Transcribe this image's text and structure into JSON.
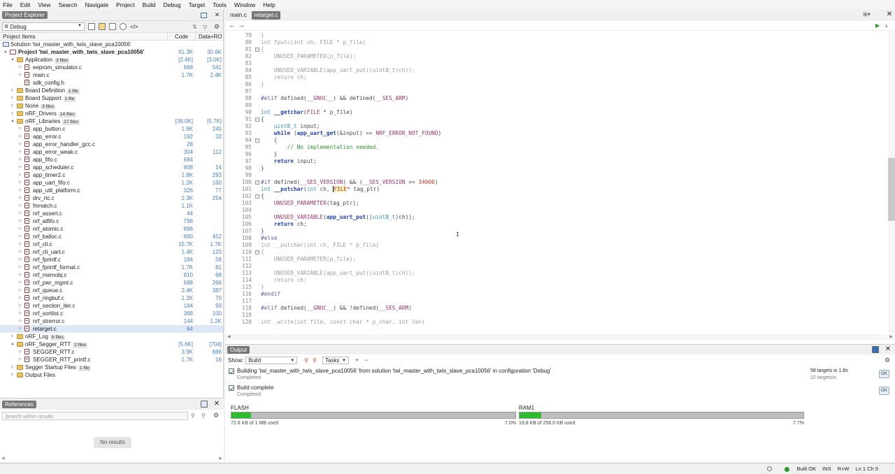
{
  "menu": [
    "File",
    "Edit",
    "View",
    "Search",
    "Navigate",
    "Project",
    "Build",
    "Debug",
    "Target",
    "Tools",
    "Window",
    "Help"
  ],
  "project_explorer": {
    "title": "Project Explorer",
    "config": "Debug",
    "columns": {
      "items": "Project Items",
      "code": "Code",
      "data": "Data+RO"
    },
    "tree": [
      {
        "label": "Solution 'twi_master_with_twis_slave_pca10056'",
        "kind": "sol",
        "depth": 0,
        "tw": "",
        "code": "",
        "data": ""
      },
      {
        "label": "Project 'twi_master_with_twis_slave_pca10056'",
        "kind": "proj",
        "depth": 0,
        "tw": "▲",
        "code": "61.3K",
        "data": "30.6K",
        "bold": true
      },
      {
        "label": "Application",
        "kind": "folder",
        "depth": 1,
        "tw": "▲",
        "badge": "3 files",
        "code": "[2.4K]",
        "data": "[3.0K]"
      },
      {
        "label": "eeprom_simulator.c",
        "kind": "file",
        "depth": 2,
        "tw": "▷",
        "code": "688",
        "data": "541"
      },
      {
        "label": "main.c",
        "kind": "file",
        "depth": 2,
        "tw": "▷",
        "code": "1.7K",
        "data": "2.4K"
      },
      {
        "label": "sdk_config.h",
        "kind": "file",
        "depth": 2,
        "tw": "",
        "code": "",
        "data": ""
      },
      {
        "label": "Board Definition",
        "kind": "folder",
        "depth": 1,
        "tw": "▷",
        "badge": "1 file",
        "code": "",
        "data": ""
      },
      {
        "label": "Board Support",
        "kind": "folder",
        "depth": 1,
        "tw": "▷",
        "badge": "1 file",
        "code": "",
        "data": ""
      },
      {
        "label": "None",
        "kind": "folder",
        "depth": 1,
        "tw": "▷",
        "badge": "3 files",
        "code": "",
        "data": ""
      },
      {
        "label": "nRF_Drivers",
        "kind": "folder",
        "depth": 1,
        "tw": "▷",
        "badge": "14 files",
        "code": "",
        "data": ""
      },
      {
        "label": "nRF_Libraries",
        "kind": "folder",
        "depth": 1,
        "tw": "▲",
        "badge": "27 files",
        "code": "[38.0K]",
        "data": "[5.7K]"
      },
      {
        "label": "app_button.c",
        "kind": "file",
        "depth": 2,
        "tw": "▷",
        "code": "1.6K",
        "data": "245"
      },
      {
        "label": "app_error.c",
        "kind": "file",
        "depth": 2,
        "tw": "▷",
        "code": "192",
        "data": "32"
      },
      {
        "label": "app_error_handler_gcc.c",
        "kind": "file",
        "depth": 2,
        "tw": "▷",
        "code": "28",
        "data": ""
      },
      {
        "label": "app_error_weak.c",
        "kind": "file",
        "depth": 2,
        "tw": "▷",
        "code": "304",
        "data": "112"
      },
      {
        "label": "app_fifo.c",
        "kind": "file",
        "depth": 2,
        "tw": "▷",
        "code": "684",
        "data": ""
      },
      {
        "label": "app_scheduler.c",
        "kind": "file",
        "depth": 2,
        "tw": "▷",
        "code": "808",
        "data": "14"
      },
      {
        "label": "app_timer2.c",
        "kind": "file",
        "depth": 2,
        "tw": "▷",
        "code": "1.8K",
        "data": "293"
      },
      {
        "label": "app_uart_fifo.c",
        "kind": "file",
        "depth": 2,
        "tw": "▷",
        "code": "1.2K",
        "data": "160"
      },
      {
        "label": "app_util_platform.c",
        "kind": "file",
        "depth": 2,
        "tw": "▷",
        "code": "326",
        "data": "77"
      },
      {
        "label": "drv_rtc.c",
        "kind": "file",
        "depth": 2,
        "tw": "▷",
        "code": "2.3K",
        "data": "254"
      },
      {
        "label": "fnmatch.c",
        "kind": "file",
        "depth": 2,
        "tw": "▷",
        "code": "1.1K",
        "data": ""
      },
      {
        "label": "nrf_assert.c",
        "kind": "file",
        "depth": 2,
        "tw": "▷",
        "code": "44",
        "data": ""
      },
      {
        "label": "nrf_atfifo.c",
        "kind": "file",
        "depth": 2,
        "tw": "▷",
        "code": "796",
        "data": ""
      },
      {
        "label": "nrf_atomic.c",
        "kind": "file",
        "depth": 2,
        "tw": "▷",
        "code": "896",
        "data": ""
      },
      {
        "label": "nrf_balloc.c",
        "kind": "file",
        "depth": 2,
        "tw": "▷",
        "code": "890",
        "data": "452"
      },
      {
        "label": "nrf_cli.c",
        "kind": "file",
        "depth": 2,
        "tw": "▷",
        "code": "15.7K",
        "data": "1.7K"
      },
      {
        "label": "nrf_cli_uart.c",
        "kind": "file",
        "depth": 2,
        "tw": "▷",
        "code": "1.4K",
        "data": "120"
      },
      {
        "label": "nrf_fprintf.c",
        "kind": "file",
        "depth": 2,
        "tw": "▷",
        "code": "184",
        "data": "58"
      },
      {
        "label": "nrf_fprintf_format.c",
        "kind": "file",
        "depth": 2,
        "tw": "▷",
        "code": "1.7K",
        "data": "81"
      },
      {
        "label": "nrf_memobj.c",
        "kind": "file",
        "depth": 2,
        "tw": "▷",
        "code": "810",
        "data": "68"
      },
      {
        "label": "nrf_pwr_mgmt.c",
        "kind": "file",
        "depth": 2,
        "tw": "▷",
        "code": "688",
        "data": "266"
      },
      {
        "label": "nrf_queue.c",
        "kind": "file",
        "depth": 2,
        "tw": "▷",
        "code": "2.4K",
        "data": "387"
      },
      {
        "label": "nrf_ringbuf.c",
        "kind": "file",
        "depth": 2,
        "tw": "▷",
        "code": "1.2K",
        "data": "70"
      },
      {
        "label": "nrf_section_iter.c",
        "kind": "file",
        "depth": 2,
        "tw": "▷",
        "code": "184",
        "data": "93"
      },
      {
        "label": "nrf_sortlist.c",
        "kind": "file",
        "depth": 2,
        "tw": "▷",
        "code": "368",
        "data": "100"
      },
      {
        "label": "nrf_strerror.c",
        "kind": "file",
        "depth": 2,
        "tw": "▷",
        "code": "144",
        "data": "1.2K"
      },
      {
        "label": "retarget.c",
        "kind": "file",
        "depth": 2,
        "tw": "▷",
        "code": "64",
        "data": "",
        "selected": true
      },
      {
        "label": "nRF_Log",
        "kind": "folder",
        "depth": 1,
        "tw": "▷",
        "badge": "6 files",
        "code": "",
        "data": ""
      },
      {
        "label": "nRF_Segger_RTT",
        "kind": "folder",
        "depth": 1,
        "tw": "▲",
        "badge": "2 files",
        "code": "[5.6K]",
        "data": "[704]"
      },
      {
        "label": "SEGGER_RTT.c",
        "kind": "file",
        "depth": 2,
        "tw": "▷",
        "code": "3.9K",
        "data": "688"
      },
      {
        "label": "SEGGER_RTT_printf.c",
        "kind": "file",
        "depth": 2,
        "tw": "▷",
        "code": "1.7K",
        "data": "16"
      },
      {
        "label": "Segger Startup Files",
        "kind": "folder",
        "depth": 1,
        "tw": "▷",
        "badge": "1 file",
        "code": "",
        "data": ""
      },
      {
        "label": "Output Files",
        "kind": "folder",
        "depth": 1,
        "tw": "▷",
        "code": "",
        "data": ""
      }
    ]
  },
  "references": {
    "title": "References",
    "search_placeholder": "Search within results",
    "empty": "No results"
  },
  "editor": {
    "tabs": [
      {
        "label": "main.c",
        "active": false
      },
      {
        "label": "retarget.c",
        "active": true
      }
    ],
    "lines": [
      {
        "n": "79",
        "fold": "",
        "html": "<span class='dim'>}</span>"
      },
      {
        "n": "80",
        "fold": "",
        "html": "<span class='ty dim'>int</span><span class='dim'> fputc(</span><span class='dim'>int</span><span class='dim'> ch, FILE * p_file)</span>"
      },
      {
        "n": "81",
        "fold": "−",
        "html": "<span class='dim'>{</span>"
      },
      {
        "n": "82",
        "fold": "",
        "html": "    <span class='dim'>UNUSED_PARAMETER(p_file);</span>"
      },
      {
        "n": "83",
        "fold": "",
        "html": ""
      },
      {
        "n": "84",
        "fold": "",
        "html": "    <span class='dim'>UNUSED_VARIABLE(app_uart_put((uint8_t)ch));</span>"
      },
      {
        "n": "85",
        "fold": "",
        "html": "    <span class='dim'>return ch;</span>"
      },
      {
        "n": "86",
        "fold": "",
        "html": "<span class='dim'>}</span>"
      },
      {
        "n": "87",
        "fold": "",
        "html": ""
      },
      {
        "n": "88",
        "fold": "",
        "html": "<span class='pp'>#elif</span> defined(<span class='mac'>__GNUC__</span>) &amp;&amp; defined(<span class='mac'>__SES_ARM</span>)"
      },
      {
        "n": "89",
        "fold": "",
        "html": ""
      },
      {
        "n": "90",
        "fold": "",
        "html": "<span class='ty'>int</span> <span class='kw'>__getchar</span>(<span class='mac'>FILE</span> * p_file)"
      },
      {
        "n": "91",
        "fold": "−",
        "html": "{"
      },
      {
        "n": "92",
        "fold": "",
        "html": "    <span class='ty'>uint8_t</span> input;"
      },
      {
        "n": "93",
        "fold": "",
        "html": "    <span class='kw'>while</span> (<span class='kw'>app_uart_get</span>(&amp;input) == <span class='mac'>NRF_ERROR_NOT_FOUND</span>)"
      },
      {
        "n": "94",
        "fold": "−",
        "html": "    {"
      },
      {
        "n": "95",
        "fold": "",
        "html": "        <span class='cm'>// No implementation needed.</span>"
      },
      {
        "n": "96",
        "fold": "",
        "html": "    }"
      },
      {
        "n": "97",
        "fold": "",
        "html": "    <span class='kw'>return</span> input;"
      },
      {
        "n": "98",
        "fold": "",
        "html": "}"
      },
      {
        "n": "99",
        "fold": "",
        "html": ""
      },
      {
        "n": "100",
        "fold": "−",
        "html": "<span class='pp'>#if</span> defined(<span class='mac'>__SES_VERSION</span>) &amp;&amp; (<span class='mac'>__SES_VERSION</span> &gt;= <span class='num'>34000</span>)"
      },
      {
        "n": "101",
        "fold": "",
        "html": "<span class='ty'>int</span> <span class='kw'>__putchar</span>(<span class='ty'>int</span> ch, <span class='hl mac'>FILE</span><span class='mac'>*</span> tag_ptr)"
      },
      {
        "n": "102",
        "fold": "−",
        "html": "{"
      },
      {
        "n": "103",
        "fold": "",
        "html": "    <span class='mac'>UNUSED_PARAMETER</span>(tag_ptr);"
      },
      {
        "n": "104",
        "fold": "",
        "html": ""
      },
      {
        "n": "105",
        "fold": "",
        "html": "    <span class='mac'>UNUSED_VARIABLE</span>(<span class='kw'>app_uart_put</span>((<span class='ty'>uint8_t</span>)ch));"
      },
      {
        "n": "106",
        "fold": "",
        "html": "    <span class='kw'>return</span> ch;"
      },
      {
        "n": "107",
        "fold": "",
        "html": "}"
      },
      {
        "n": "108",
        "fold": "",
        "html": "<span class='pp'>#else</span>"
      },
      {
        "n": "109",
        "fold": "",
        "html": "<span class='dim'>int __putchar(int ch, FILE * p_file)</span>"
      },
      {
        "n": "110",
        "fold": "−",
        "html": "<span class='dim'>{</span>"
      },
      {
        "n": "111",
        "fold": "",
        "html": "    <span class='dim'>UNUSED_PARAMETER(p_file);</span>"
      },
      {
        "n": "112",
        "fold": "",
        "html": ""
      },
      {
        "n": "113",
        "fold": "",
        "html": "    <span class='dim'>UNUSED_VARIABLE(app_uart_put((uint8_t)ch));</span>"
      },
      {
        "n": "114",
        "fold": "",
        "html": "    <span class='dim'>return ch;</span>"
      },
      {
        "n": "115",
        "fold": "",
        "html": "<span class='dim'>}</span>"
      },
      {
        "n": "116",
        "fold": "",
        "html": "<span class='pp'>#endif</span>"
      },
      {
        "n": "117",
        "fold": "",
        "html": ""
      },
      {
        "n": "118",
        "fold": "",
        "html": "<span class='pp'>#elif</span> defined(<span class='mac'>__GNUC__</span>) &amp;&amp; !defined(<span class='mac'>__SES_ARM</span>)"
      },
      {
        "n": "119",
        "fold": "",
        "html": ""
      },
      {
        "n": "120",
        "fold": "",
        "html": "<span class='dim'>int _write(int file, const char * p_char, int len)</span>"
      }
    ]
  },
  "output": {
    "title": "Output",
    "show_label": "Show:",
    "show_value": "Build",
    "tasks_label": "Tasks",
    "messages": [
      {
        "title": "Building 'twi_master_with_twis_slave_pca10056' from solution 'twi_master_with_twis_slave_pca10056' in configuration 'Debug'",
        "sub": "Completed",
        "stat1": "58 targets in 1.8s",
        "stat2": "32 targets/s",
        "btn": "OK"
      },
      {
        "title": "Build complete",
        "sub": "Completed",
        "stat1": "",
        "stat2": "",
        "btn": "OK"
      }
    ],
    "memory": [
      {
        "name": "FLASH",
        "used": "72.6 KB of 1 MB used",
        "pct": "7.0%",
        "fraction": 0.07
      },
      {
        "name": "RAM1",
        "used": "19.8 KB of 256.0 KB used",
        "pct": "7.7%",
        "fraction": 0.077
      }
    ]
  },
  "status": {
    "build": "Built OK",
    "ins": "INS",
    "rw": "R+W",
    "pos": "Ln 1 Ch 5"
  }
}
